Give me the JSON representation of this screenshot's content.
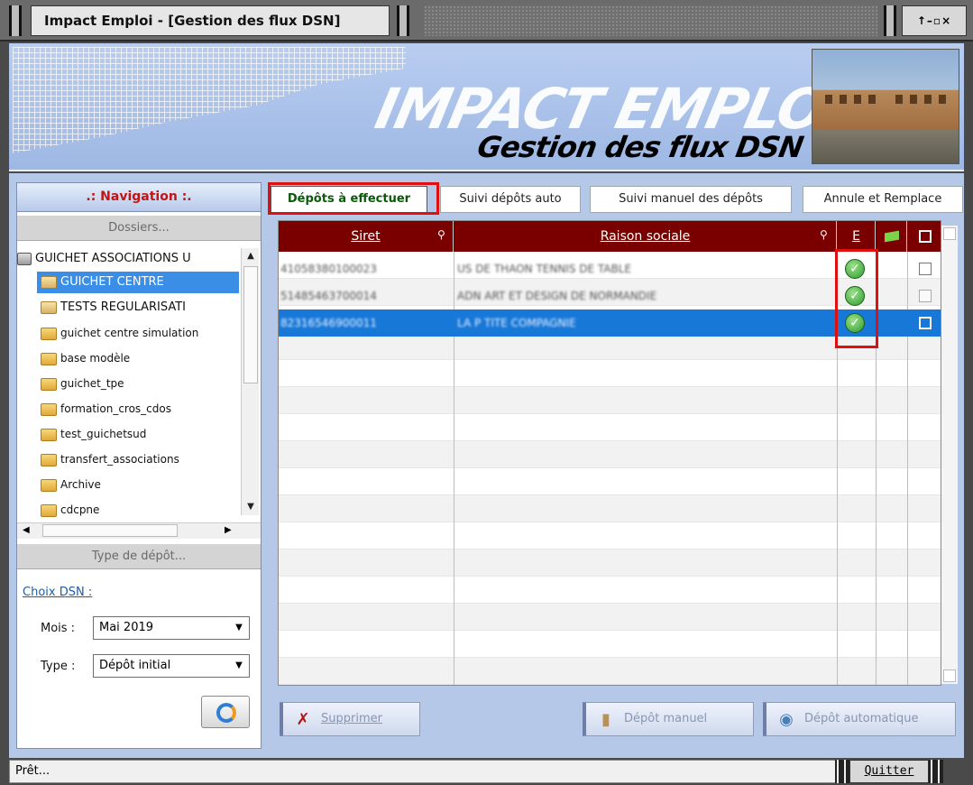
{
  "window": {
    "title": "Impact Emploi - [Gestion des flux DSN]",
    "controls": "↑–▫×"
  },
  "banner": {
    "title": "IMPACT EMPLOI",
    "subtitle": "Gestion des flux DSN"
  },
  "navigation": {
    "header": ".: Navigation :.",
    "dossiers_header": "Dossiers...",
    "tree": [
      {
        "label": "GUICHET ASSOCIATIONS U",
        "icon": "root-icon"
      },
      {
        "label": "GUICHET CENTRE",
        "icon": "folder-note-icon",
        "selected": true
      },
      {
        "label": "TESTS  REGULARISATI",
        "icon": "folder-note-icon"
      },
      {
        "label": "guichet centre simulation",
        "icon": "folder-icon"
      },
      {
        "label": "base modèle",
        "icon": "folder-icon"
      },
      {
        "label": "guichet_tpe",
        "icon": "folder-icon"
      },
      {
        "label": "formation_cros_cdos",
        "icon": "folder-icon"
      },
      {
        "label": "test_guichetsud",
        "icon": "folder-icon"
      },
      {
        "label": "transfert_associations",
        "icon": "folder-icon"
      },
      {
        "label": "Archive",
        "icon": "folder-icon"
      },
      {
        "label": "cdcpne",
        "icon": "folder-icon"
      }
    ],
    "type_depot_header": "Type de dépôt...",
    "choix_dsn": "Choix DSN :",
    "mois_label": "Mois :",
    "mois_value": "Mai 2019",
    "type_label": "Type :",
    "type_value": "Dépôt initial"
  },
  "tabs": [
    {
      "label": "Dépôts à effectuer",
      "active": true
    },
    {
      "label": "Suivi dépôts auto"
    },
    {
      "label": "Suivi manuel des dépôts"
    },
    {
      "label": "Annule et Remplace"
    }
  ],
  "grid": {
    "columns": [
      "Siret",
      "Raison sociale",
      "E"
    ],
    "rows": [
      {
        "siret": "41058380100023",
        "raison": "US DE THAON TENNIS DE TABLE",
        "e": true,
        "selected": false
      },
      {
        "siret": "51485463700014",
        "raison": "ADN ART ET DESIGN DE NORMANDIE",
        "e": true,
        "selected": false
      },
      {
        "siret": "82316546900011",
        "raison": "LA P TITE COMPAGNIE",
        "e": true,
        "selected": true
      }
    ]
  },
  "actions": {
    "delete": "Supprimer",
    "manual": "Dépôt manuel",
    "auto": "Dépôt automatique"
  },
  "status": {
    "text": "Prêt...",
    "quit": "Quitter"
  },
  "colors": {
    "grid_header": "#7a0000",
    "selection": "#1878d8",
    "highlight": "#e01010"
  }
}
